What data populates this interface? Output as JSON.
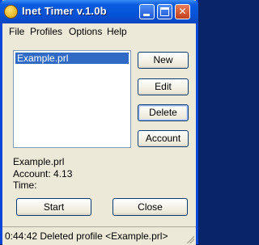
{
  "window": {
    "title": "Inet Timer v.1.0b",
    "icon_label": "INET"
  },
  "menu": {
    "items": [
      "File",
      "Profiles",
      "Options",
      "Help"
    ]
  },
  "profiles_list": {
    "items": [
      "Example.prl"
    ],
    "selected_index": 0
  },
  "buttons": {
    "new": "New",
    "edit": "Edit",
    "delete": "Delete",
    "account": "Account",
    "start": "Start",
    "close": "Close"
  },
  "info": {
    "profile_name": "Example.prl",
    "account_line": "Account: 4.13",
    "time_line": "Time:"
  },
  "status": {
    "text": "0:44:42 Deleted profile <Example.prl>"
  },
  "colors": {
    "title_bar": "#0553d8",
    "selection": "#316ac5",
    "window_bg": "#ece9d8"
  }
}
